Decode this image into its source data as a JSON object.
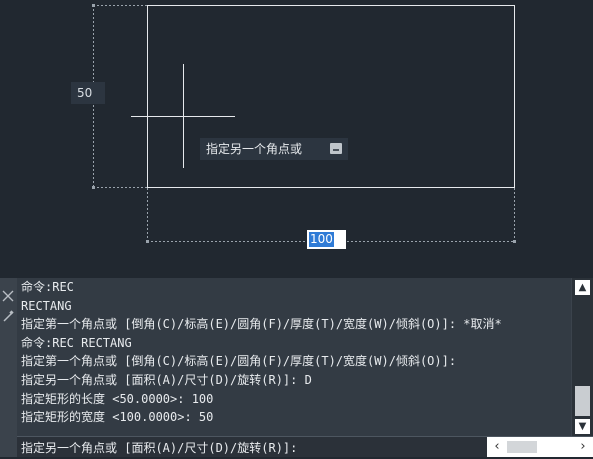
{
  "canvas": {
    "dimension_height": "50",
    "dimension_width": "100",
    "tooltip_text": "指定另一个角点或"
  },
  "command_window": {
    "history": [
      "命令:REC",
      "RECTANG",
      "指定第一个角点或 [倒角(C)/标高(E)/圆角(F)/厚度(T)/宽度(W)/倾斜(O)]: *取消*",
      "命令:REC RECTANG",
      "指定第一个角点或 [倒角(C)/标高(E)/圆角(F)/厚度(T)/宽度(W)/倾斜(O)]:",
      "指定另一个角点或 [面积(A)/尺寸(D)/旋转(R)]: D",
      "指定矩形的长度 <50.0000>: 100",
      "指定矩形的宽度 <100.0000>: 50"
    ],
    "prompt": "指定另一个角点或 [面积(A)/尺寸(D)/旋转(R)]:"
  },
  "icons": {
    "close": "close-icon",
    "customize": "customize-icon",
    "keyboard": "keyboard-icon"
  },
  "colors": {
    "canvas_bg": "#212830",
    "selection": "#2f7bd6",
    "command_bg": "#333b44"
  }
}
